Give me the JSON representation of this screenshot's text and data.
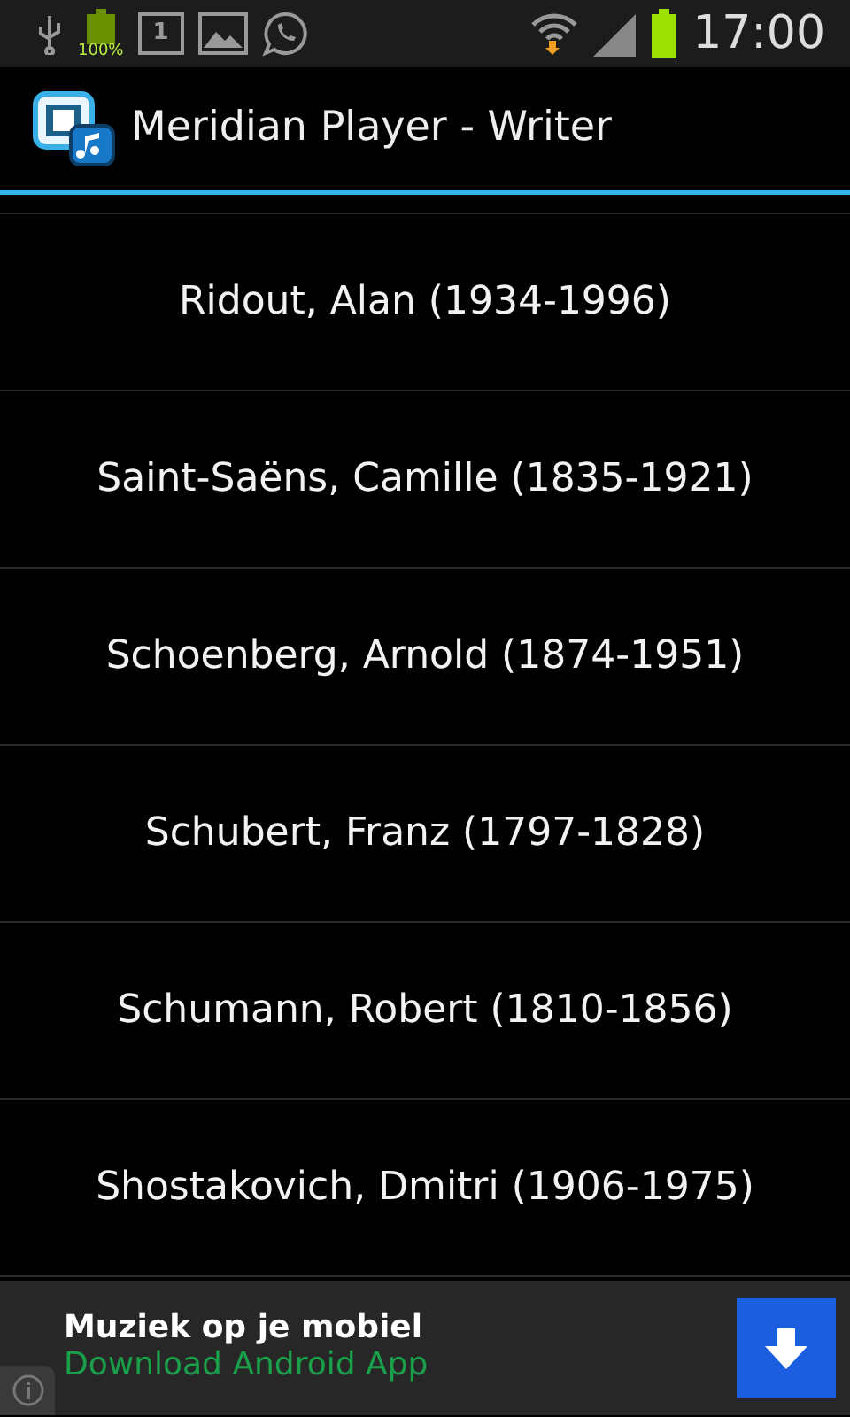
{
  "status_bar": {
    "battery_percent": "100%",
    "calendar_day": "1",
    "time": "17:00"
  },
  "action_bar": {
    "title": "Meridian Player - Writer"
  },
  "writers": [
    {
      "name": "Ridout, Alan (1934-1996)"
    },
    {
      "name": "Saint-Saëns, Camille (1835-1921)"
    },
    {
      "name": "Schoenberg, Arnold (1874-1951)"
    },
    {
      "name": "Schubert, Franz (1797-1828)"
    },
    {
      "name": "Schumann, Robert (1810-1856)"
    },
    {
      "name": "Shostakovich, Dmitri (1906-1975)"
    }
  ],
  "ad": {
    "title": "Muziek op je mobiel",
    "subtitle": "Download Android App"
  }
}
